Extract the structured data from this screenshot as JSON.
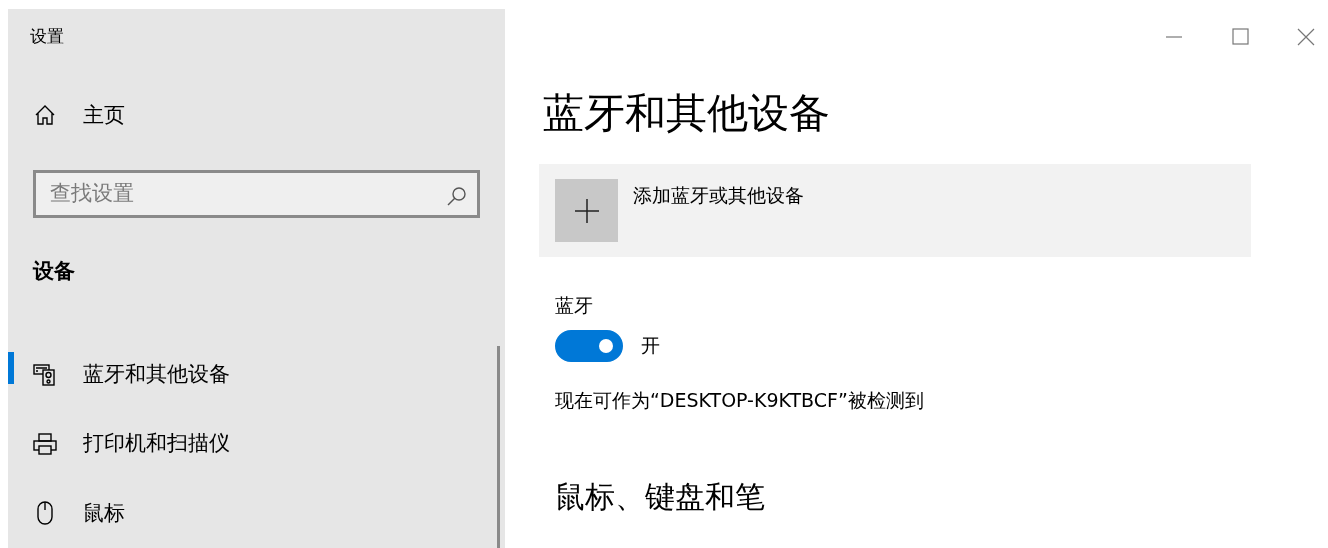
{
  "window": {
    "title": "设置",
    "controls": [
      {
        "kind": "minimize"
      },
      {
        "kind": "maximize"
      },
      {
        "kind": "close"
      }
    ]
  },
  "sidebar": {
    "home": {
      "label": "主页"
    },
    "search": {
      "placeholder": "查找设置"
    },
    "section": "设备",
    "items": [
      {
        "kind": "devices",
        "label": "蓝牙和其他设备",
        "selected": true
      },
      {
        "kind": "printer",
        "label": "打印机和扫描仪",
        "selected": false
      },
      {
        "kind": "mouse",
        "label": "鼠标",
        "selected": false
      }
    ]
  },
  "main": {
    "title": "蓝牙和其他设备",
    "add_button": {
      "label": "添加蓝牙或其他设备"
    },
    "bluetooth": {
      "label": "蓝牙",
      "on": true,
      "state_label": "开",
      "discoverable_text": "现在可作为“DESKTOP-K9KTBCF”被检测到"
    },
    "next_section": "鼠标、键盘和笔"
  }
}
